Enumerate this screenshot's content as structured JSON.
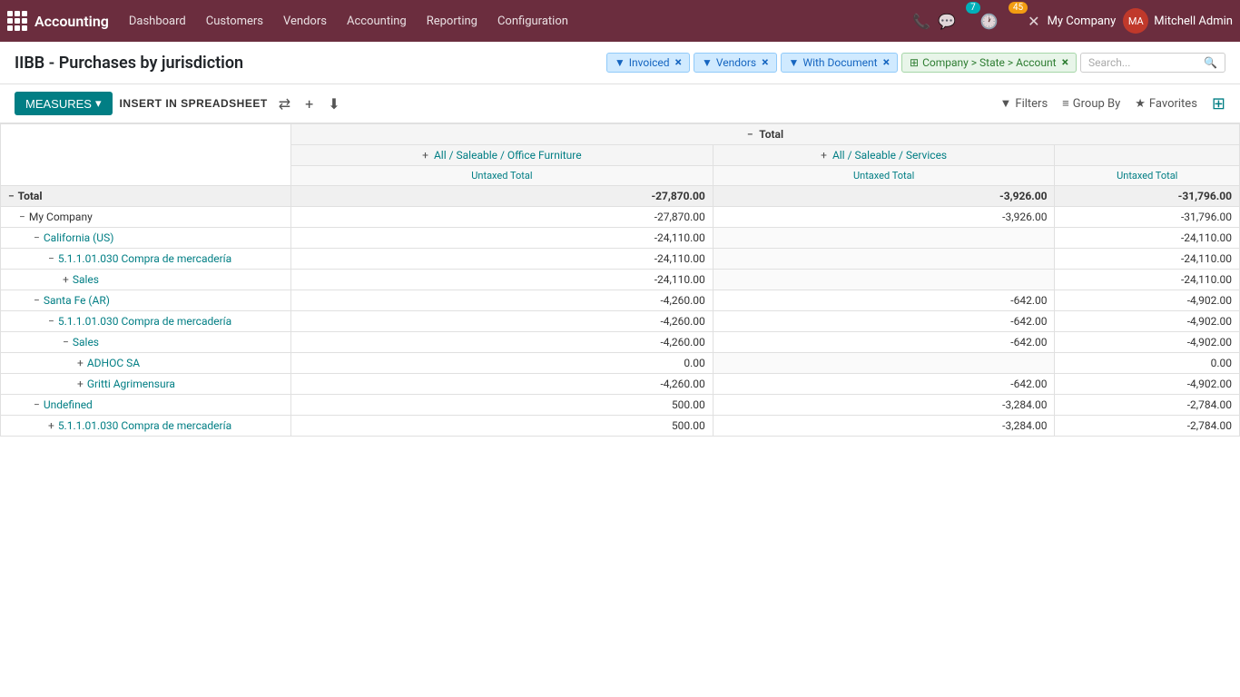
{
  "app": {
    "brand": "Accounting",
    "nav_items": [
      "Dashboard",
      "Customers",
      "Vendors",
      "Accounting",
      "Reporting",
      "Configuration"
    ],
    "badge_chat": "7",
    "badge_clock": "45",
    "company": "My Company",
    "user": "Mitchell Admin"
  },
  "page": {
    "title": "IIBB - Purchases by jurisdiction"
  },
  "filters": [
    {
      "id": "invoiced",
      "label": "Invoiced",
      "type": "blue"
    },
    {
      "id": "vendors",
      "label": "Vendors",
      "type": "blue"
    },
    {
      "id": "with_document",
      "label": "With Document",
      "type": "blue"
    },
    {
      "id": "group_by",
      "label": "Company > State > Account",
      "type": "grid"
    }
  ],
  "search": {
    "placeholder": "Search..."
  },
  "toolbar": {
    "measures_label": "MEASURES",
    "insert_label": "INSERT IN SPREADSHEET",
    "filters_label": "Filters",
    "groupby_label": "Group By",
    "favorites_label": "Favorites"
  },
  "table": {
    "col_headers": [
      {
        "group": "Total",
        "cols": [
          {
            "sub": "All / Saleable / Office Furniture",
            "metric": "Untaxed Total"
          },
          {
            "sub": "All / Saleable / Services",
            "metric": "Untaxed Total"
          },
          {
            "sub": "",
            "metric": "Untaxed Total"
          }
        ]
      }
    ],
    "rows": [
      {
        "level": 0,
        "expand": "minus",
        "label": "Total",
        "v1": "-27,870.00",
        "v2": "-3,926.00",
        "v3": "-31,796.00",
        "class": "total-row"
      },
      {
        "level": 1,
        "expand": "minus",
        "label": "My Company",
        "v1": "-27,870.00",
        "v2": "-3,926.00",
        "v3": "-31,796.00",
        "class": "sub-row-1"
      },
      {
        "level": 2,
        "expand": "minus",
        "label": "California (US)",
        "v1": "-24,110.00",
        "v2": "",
        "v3": "-24,110.00",
        "class": "sub-row-2"
      },
      {
        "level": 3,
        "expand": "minus",
        "label": "5.1.1.01.030 Compra de mercadería",
        "v1": "-24,110.00",
        "v2": "",
        "v3": "-24,110.00",
        "class": "sub-row-3"
      },
      {
        "level": 4,
        "expand": "plus",
        "label": "Sales",
        "v1": "-24,110.00",
        "v2": "",
        "v3": "-24,110.00",
        "class": "sub-row-4"
      },
      {
        "level": 2,
        "expand": "minus",
        "label": "Santa Fe (AR)",
        "v1": "-4,260.00",
        "v2": "-642.00",
        "v3": "-4,902.00",
        "class": "sub-row-2"
      },
      {
        "level": 3,
        "expand": "minus",
        "label": "5.1.1.01.030 Compra de mercadería",
        "v1": "-4,260.00",
        "v2": "-642.00",
        "v3": "-4,902.00",
        "class": "sub-row-3"
      },
      {
        "level": 4,
        "expand": "minus",
        "label": "Sales",
        "v1": "-4,260.00",
        "v2": "-642.00",
        "v3": "-4,902.00",
        "class": "sub-row-4"
      },
      {
        "level": 5,
        "expand": "plus",
        "label": "ADHOC SA",
        "v1": "0.00",
        "v2": "",
        "v3": "0.00",
        "class": "sub-row-5"
      },
      {
        "level": 5,
        "expand": "plus",
        "label": "Gritti Agrimensura",
        "v1": "-4,260.00",
        "v2": "-642.00",
        "v3": "-4,902.00",
        "class": "sub-row-5"
      },
      {
        "level": 2,
        "expand": "minus",
        "label": "Undefined",
        "v1": "500.00",
        "v2": "-3,284.00",
        "v3": "-2,784.00",
        "class": "sub-row-2"
      },
      {
        "level": 3,
        "expand": "plus",
        "label": "5.1.1.01.030 Compra de mercadería",
        "v1": "500.00",
        "v2": "-3,284.00",
        "v3": "-2,784.00",
        "class": "sub-row-3"
      }
    ]
  }
}
